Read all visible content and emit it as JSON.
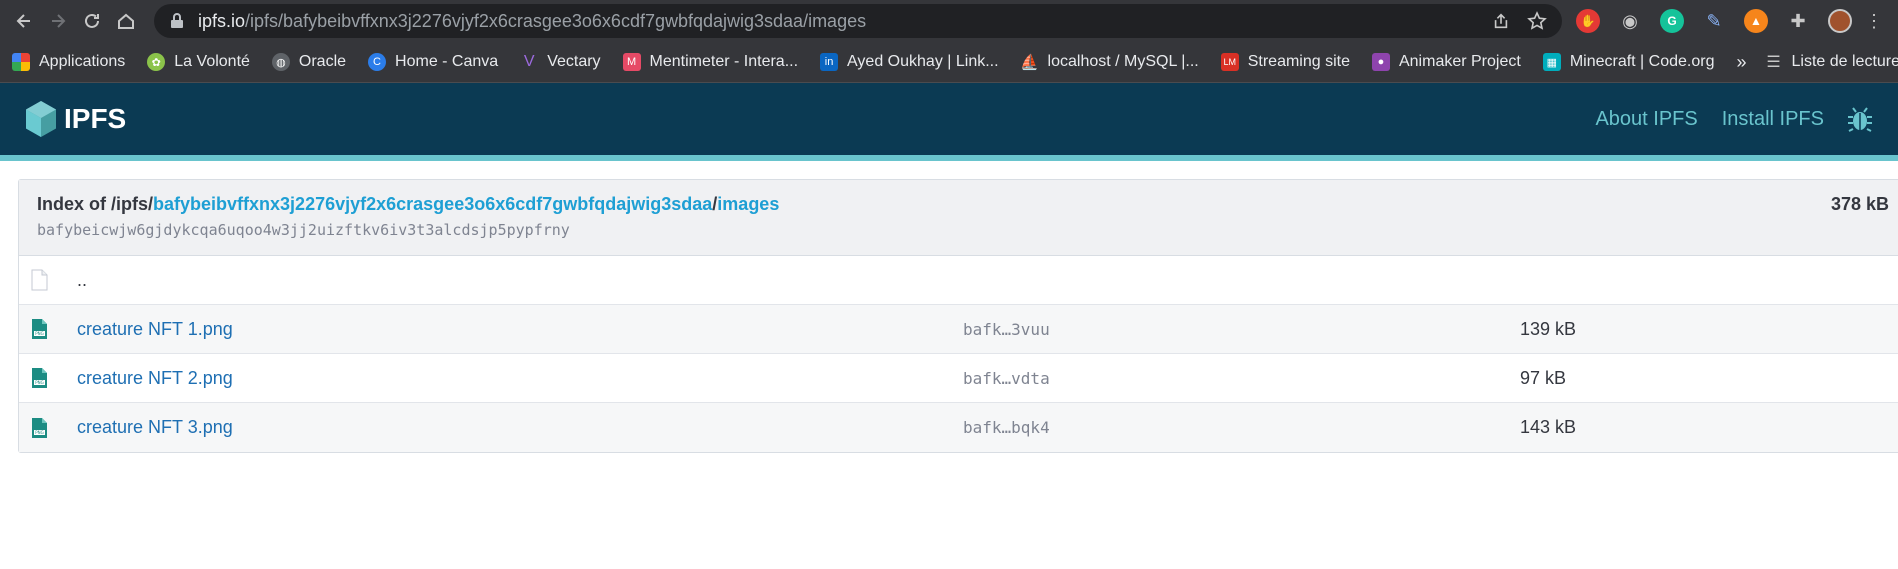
{
  "browser": {
    "url_host": "ipfs.io",
    "url_path": "/ipfs/bafybeibvffxnx3j2276vjyf2x6crasgee3o6x6cdf7gwbfqdajwig3sdaa/images",
    "bookmarks": [
      {
        "label": "Applications",
        "icon": "apps-grid-icon",
        "color": "#e94235"
      },
      {
        "label": "La Volonté",
        "icon": "leaf-icon",
        "color": "#8bc34a"
      },
      {
        "label": "Oracle",
        "icon": "globe-icon",
        "color": "#9aa0a6"
      },
      {
        "label": "Home - Canva",
        "icon": "canva-icon",
        "color": "#2b7de9"
      },
      {
        "label": "Vectary",
        "icon": "vectary-icon",
        "color": "#7e57c2"
      },
      {
        "label": "Mentimeter - Intera...",
        "icon": "mentimeter-icon",
        "color": "#e64a66"
      },
      {
        "label": "Ayed Oukhay | Link...",
        "icon": "linkedin-icon",
        "color": "#0a66c2"
      },
      {
        "label": "localhost / MySQL |...",
        "icon": "phpmyadmin-icon",
        "color": "#f29111"
      },
      {
        "label": "Streaming site",
        "icon": "streaming-icon",
        "color": "#d93025"
      },
      {
        "label": "Animaker Project",
        "icon": "animaker-icon",
        "color": "#8e44ad"
      },
      {
        "label": "Minecraft | Code.org",
        "icon": "codeorg-icon",
        "color": "#00adbc"
      }
    ],
    "more_label": "»",
    "reading_list_label": "Liste de lecture"
  },
  "header": {
    "logo_text": "IPFS",
    "nav": [
      "About IPFS",
      "Install IPFS"
    ]
  },
  "index": {
    "title_prefix": "Index of /ipfs/",
    "title_cid": "bafybeibvffxnx3j2276vjyf2x6crasgee3o6x6cdf7gwbfqdajwig3sdaa",
    "title_sep": "/",
    "title_dir": "images",
    "cid": "bafybeicwjw6gjdykcqa6uqoo4w3jj2uizftkv6iv3t3alcdsjp5pypfrny",
    "total_size": "378 kB",
    "parent_label": "..",
    "files": [
      {
        "name": "creature NFT 1.png",
        "hash": "bafk…3vuu",
        "size": "139 kB"
      },
      {
        "name": "creature NFT 2.png",
        "hash": "bafk…vdta",
        "size": "97 kB"
      },
      {
        "name": "creature NFT 3.png",
        "hash": "bafk…bqk4",
        "size": "143 kB"
      }
    ]
  },
  "colors": {
    "header_bg": "#0b3a53",
    "accent": "#69c4cd",
    "link": "#1e6fb3"
  }
}
